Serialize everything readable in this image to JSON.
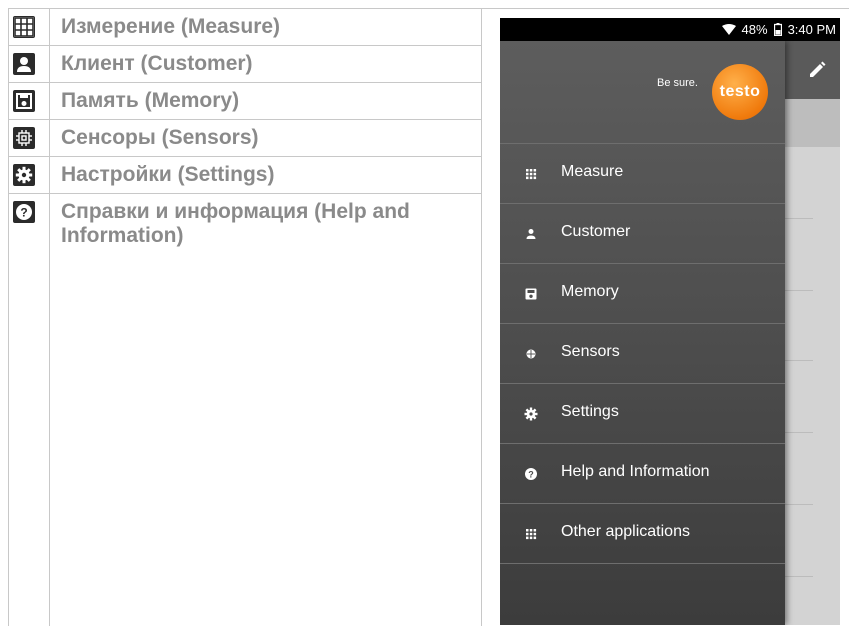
{
  "doc_rows": [
    {
      "icon": "grid-icon",
      "label": "Измерение (Measure)"
    },
    {
      "icon": "person-icon",
      "label": "Клиент (Customer)"
    },
    {
      "icon": "save-icon",
      "label": "Память (Memory)"
    },
    {
      "icon": "chip-icon",
      "label": "Сенсоры (Sensors)"
    },
    {
      "icon": "gear-icon",
      "label": "Настройки (Settings)"
    },
    {
      "icon": "help-icon",
      "label": "Справки и информация (Help and Information)"
    }
  ],
  "status_bar": {
    "battery": "48%",
    "time": "3:40 PM"
  },
  "brand": {
    "tagline": "Be sure.",
    "logo": "testo",
    "accent": "#f07a0c"
  },
  "menu": [
    {
      "icon": "grid-icon",
      "label": "Measure"
    },
    {
      "icon": "person-icon",
      "label": "Customer"
    },
    {
      "icon": "save-icon",
      "label": "Memory"
    },
    {
      "icon": "sensor-icon",
      "label": "Sensors"
    },
    {
      "icon": "gear-icon",
      "label": "Settings"
    },
    {
      "icon": "help-icon",
      "label": "Help and Information"
    },
    {
      "icon": "grid-icon",
      "label": "Other applications"
    }
  ]
}
